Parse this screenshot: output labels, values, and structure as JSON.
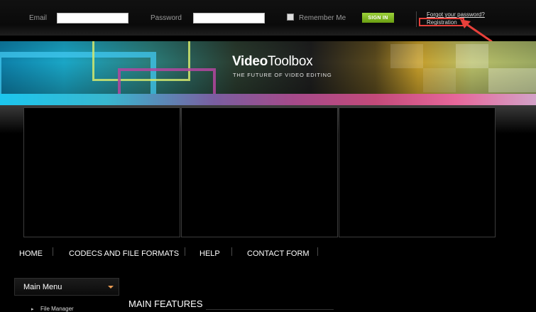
{
  "login": {
    "email_label": "Email",
    "email_value": "",
    "password_label": "Password",
    "password_value": "",
    "remember_label": "Remember Me",
    "remember_checked": false,
    "signin_label": "SIGN IN",
    "forgot_label": "Forgot your password?",
    "registration_label": "Registration",
    "highlight_color": "#e8403a"
  },
  "banner": {
    "logo_part1": "Video",
    "logo_part2": "Toolbox",
    "tagline": "THE FUTURE OF VIDEO EDITING"
  },
  "nav": {
    "items": [
      "HOME",
      "CODECS AND FILE FORMATS",
      "HELP",
      "CONTACT FORM"
    ]
  },
  "sidebar": {
    "menu_title": "Main Menu",
    "items": [
      "File Manager"
    ]
  },
  "main": {
    "heading": "MAIN FEATURES"
  },
  "colors": {
    "accent_green": "#8cc63f",
    "menu_caret": "#e89a52"
  }
}
